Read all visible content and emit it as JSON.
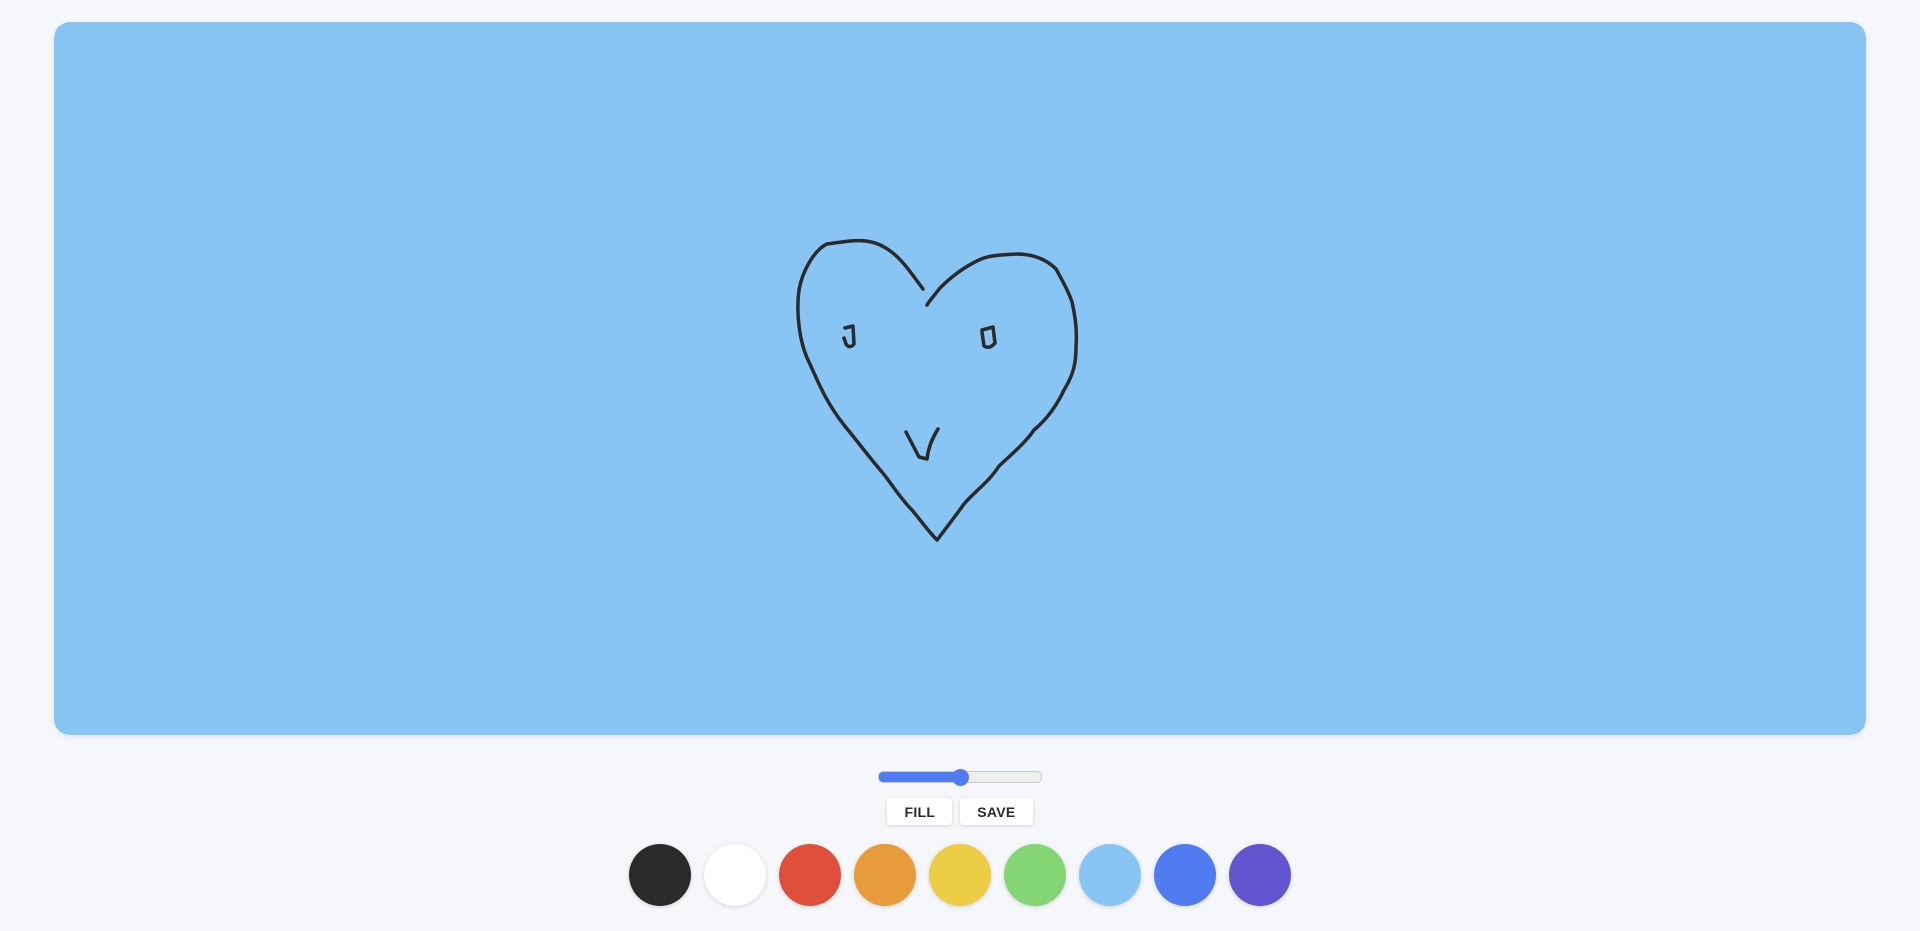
{
  "canvas": {
    "background_color": "#88c5f4",
    "stroke_color": "#2a2a2a",
    "drawing": "heart-face"
  },
  "brush_size": {
    "value_fraction": 0.5,
    "fill_color": "#517cf1",
    "track_color": "#eeeeee"
  },
  "toolbar": {
    "fill_label": "FILL",
    "save_label": "SAVE"
  },
  "palette": {
    "colors": [
      {
        "name": "black",
        "hex": "#2a2a2a"
      },
      {
        "name": "white",
        "hex": "#ffffff"
      },
      {
        "name": "red",
        "hex": "#de4f3c"
      },
      {
        "name": "orange",
        "hex": "#e89b3a"
      },
      {
        "name": "yellow",
        "hex": "#eecd46"
      },
      {
        "name": "green",
        "hex": "#84d574"
      },
      {
        "name": "light-blue",
        "hex": "#88c5f4"
      },
      {
        "name": "blue",
        "hex": "#517cf1"
      },
      {
        "name": "purple",
        "hex": "#6355cf"
      }
    ]
  }
}
